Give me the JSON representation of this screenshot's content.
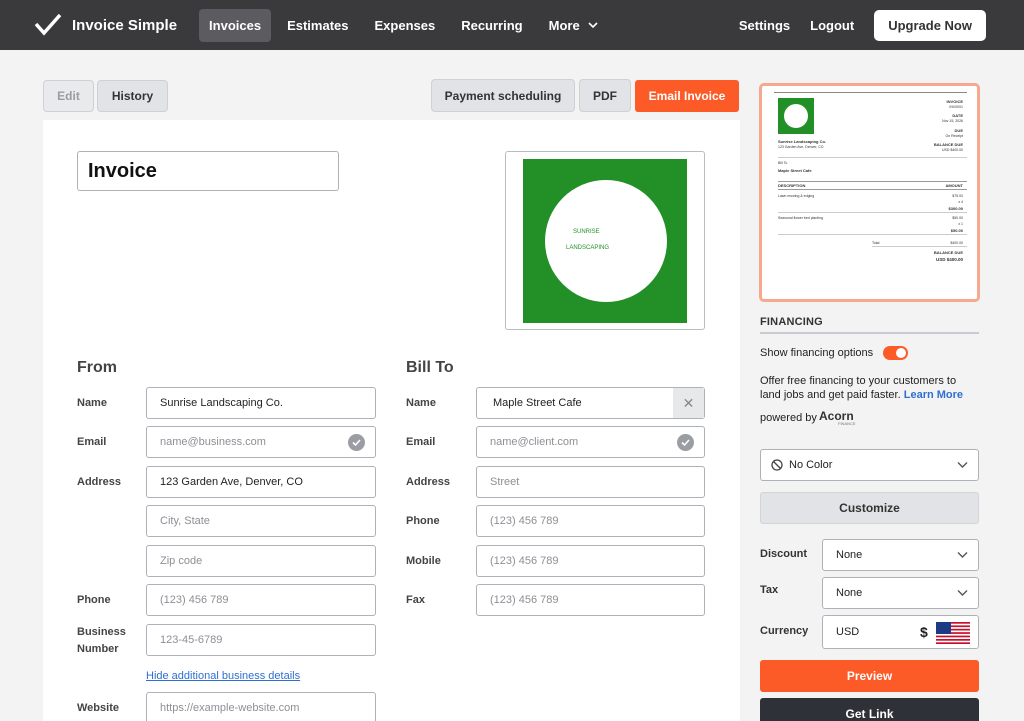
{
  "brand": {
    "name": "Invoice Simple"
  },
  "nav": {
    "items": [
      "Invoices",
      "Estimates",
      "Expenses",
      "Recurring",
      "More"
    ],
    "settings": "Settings",
    "logout": "Logout",
    "upgrade": "Upgrade Now"
  },
  "actions": {
    "edit": "Edit",
    "history": "History",
    "payment_scheduling": "Payment scheduling",
    "pdf": "PDF",
    "email_invoice": "Email Invoice"
  },
  "doc": {
    "title": "Invoice",
    "logo_line1": "SUNRISE",
    "logo_line2": "LANDSCAPING"
  },
  "from": {
    "heading": "From",
    "name_label": "Name",
    "name_value": "Sunrise Landscaping Co.",
    "email_label": "Email",
    "email_placeholder": "name@business.com",
    "address_label": "Address",
    "address_value": "123 Garden Ave, Denver, CO",
    "city_placeholder": "City, State",
    "zip_placeholder": "Zip code",
    "phone_label": "Phone",
    "phone_placeholder": "(123) 456 789",
    "business_label_1": "Business",
    "business_label_2": "Number",
    "business_placeholder": "123-45-6789",
    "hide_link": "Hide additional business details",
    "website_label": "Website",
    "website_placeholder": "https://example-website.com"
  },
  "billto": {
    "heading": "Bill To",
    "name_label": "Name",
    "name_value": "Maple Street Cafe",
    "email_label": "Email",
    "email_placeholder": "name@client.com",
    "address_label": "Address",
    "address_placeholder": "Street",
    "phone_label": "Phone",
    "phone_placeholder": "(123) 456 789",
    "mobile_label": "Mobile",
    "mobile_placeholder": "(123) 456 789",
    "fax_label": "Fax",
    "fax_placeholder": "(123) 456 789"
  },
  "thumbnail": {
    "r1": "INVOICE",
    "r2": "INV0001",
    "r3": "DATE",
    "r4": "Nov 15, 2026",
    "r5": "DUE",
    "r6": "On Receipt",
    "r7": "BALANCE DUE",
    "r8": "USD $400.00",
    "company": "Sunrise Landscaping Co.",
    "address": "123 Garden Ave, Denver, CO",
    "bill_to": "Bill To",
    "client": "Maple Street Cafe",
    "col_desc": "DESCRIPTION",
    "col_amount": "AMOUNT",
    "item1": "Lawn mowing & edging",
    "item1_rate": "$75.00",
    "item1_qty": "x 4",
    "item1_amt": "$300.00",
    "item2": "Seasonal flower bed planting",
    "item2_rate": "$50.00",
    "item2_qty": "x 1",
    "item2_amt": "$50.00",
    "total_label": "Total",
    "total": "$400.00",
    "balance_label": "BALANCE DUE",
    "balance": "USD $400.00"
  },
  "sidebar": {
    "financing_heading": "FINANCING",
    "show_financing": "Show financing options",
    "offer_text_1": "Offer free financing to your customers to",
    "offer_text_2": "land jobs and get paid faster.",
    "learn_more": "Learn More",
    "powered_by": "powered by",
    "acorn": "Acorn",
    "acorn_sub": "FINANCE",
    "color": "No Color",
    "customize": "Customize",
    "discount_label": "Discount",
    "discount_value": "None",
    "tax_label": "Tax",
    "tax_value": "None",
    "currency_label": "Currency",
    "currency_value": "USD",
    "currency_symbol": "$",
    "preview": "Preview",
    "get_link": "Get Link"
  },
  "colors": {
    "accent": "#fc5a26",
    "nav_bg": "#3a3a3d",
    "logo_green": "#229026"
  }
}
